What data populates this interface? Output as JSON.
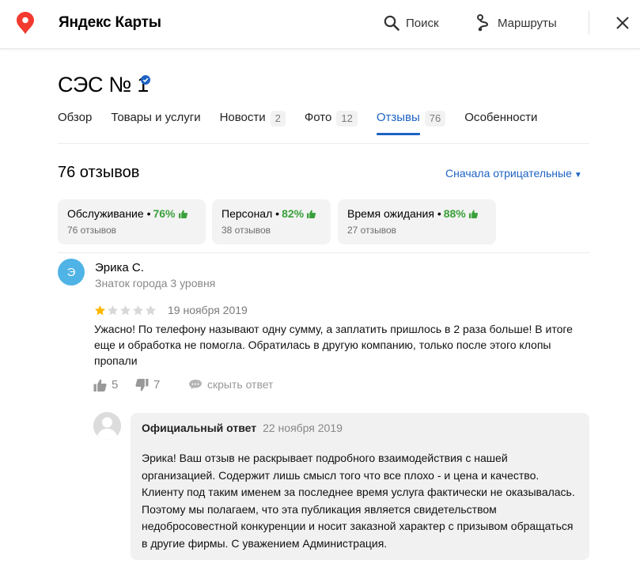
{
  "topbar": {
    "brand": "Яндекс Карты",
    "search_label": "Поиск",
    "routes_label": "Маршруты"
  },
  "org": {
    "title": "СЭС № 1"
  },
  "tabs": [
    {
      "label": "Обзор",
      "count": ""
    },
    {
      "label": "Товары и услуги",
      "count": ""
    },
    {
      "label": "Новости",
      "count": "2"
    },
    {
      "label": "Фото",
      "count": "12"
    },
    {
      "label": "Отзывы",
      "count": "76",
      "active": true
    },
    {
      "label": "Особенности",
      "count": ""
    }
  ],
  "reviews": {
    "count_title": "76 отзывов",
    "sort_label": "Сначала отрицательные",
    "sort_arrow": "▼"
  },
  "aspects": [
    {
      "name": "Обслуживание",
      "dot": "•",
      "percent": "76%",
      "sub": "76 отзывов"
    },
    {
      "name": "Персонал",
      "dot": "•",
      "percent": "82%",
      "sub": "38 отзывов"
    },
    {
      "name": "Время ожидания",
      "dot": "•",
      "percent": "88%",
      "sub": "27 отзывов"
    }
  ],
  "review": {
    "avatar_letter": "Э",
    "author": "Эрика С.",
    "level": "Знаток города 3 уровня",
    "rating": 1,
    "rating_max": 5,
    "date": "19 ноября 2019",
    "text": "Ужасно! По телефону называют одну сумму, а заплатить пришлось в 2 раза больше! В итоге еще и обработка не помогла. Обратилась в другую компанию, только после этого клопы пропали",
    "likes": "5",
    "dislikes": "7",
    "hide_answer": "скрыть ответ"
  },
  "answer": {
    "label": "Официальный ответ",
    "date": "22 ноября 2019",
    "text": "Эрика! Ваш отзыв не раскрывает подробного взаимодействия с нашей организацией. Содержит лишь смысл того что все плохо - и цена и качество. Клиенту под таким именем за последнее время услуга фактически не оказывалась. Поэтому мы полагаем, что эта публикация является свидетельством недобросовестной конкуренции и носит заказной характер с призывом обращаться в другие фирмы. С уважением Администрация."
  },
  "colors": {
    "accent": "#1e63c4",
    "positive": "#3aa03a",
    "pin": "#f33a30",
    "star_filled": "#fcb800",
    "star_empty": "#d8d8d8",
    "avatar": "#4fb3e6"
  },
  "icons": [
    "map-pin-icon",
    "search-icon",
    "routes-icon",
    "close-icon",
    "verified-icon",
    "thumb-up-icon",
    "thumb-down-icon",
    "comment-icon",
    "star-icon",
    "org-avatar-icon"
  ]
}
